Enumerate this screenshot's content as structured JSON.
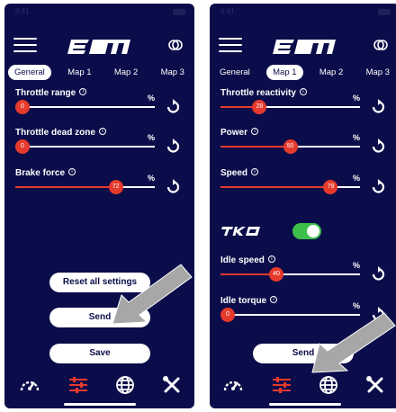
{
  "status": {
    "time": "9:41"
  },
  "colors": {
    "background": "#0b0c4a",
    "accent": "#e63a2c",
    "toggle_on": "#3cbf4a",
    "arrow": "#a7a7a7"
  },
  "icons": {
    "menu": "hamburger-icon",
    "link": "link-icon",
    "reset": "reset-icon",
    "info": "info-icon",
    "nav": [
      "speedometer-icon",
      "sliders-icon",
      "globe-icon",
      "tools-icon"
    ]
  },
  "tabs": [
    "General",
    "Map 1",
    "Map 2",
    "Map 3"
  ],
  "left": {
    "active_tab": 0,
    "sliders": [
      {
        "label": "Throttle range",
        "unit": "%",
        "value": 0
      },
      {
        "label": "Throttle dead zone",
        "unit": "%",
        "value": 0
      },
      {
        "label": "Brake force",
        "unit": "%",
        "value": 72
      }
    ],
    "buttons": {
      "reset": "Reset all settings",
      "send": "Send",
      "save": "Save"
    }
  },
  "right": {
    "active_tab": 1,
    "sliders": [
      {
        "label": "Throttle reactivity",
        "unit": "%",
        "value": 28
      },
      {
        "label": "Power",
        "unit": "%",
        "value": 50
      },
      {
        "label": "Speed",
        "unit": "%",
        "value": 79
      }
    ],
    "tko": {
      "label": "TKO",
      "enabled": true
    },
    "idle_sliders": [
      {
        "label": "Idle speed",
        "unit": "%",
        "value": 40
      },
      {
        "label": "Idle torque",
        "unit": "%",
        "value": 0
      }
    ],
    "buttons": {
      "send": "Send"
    }
  }
}
